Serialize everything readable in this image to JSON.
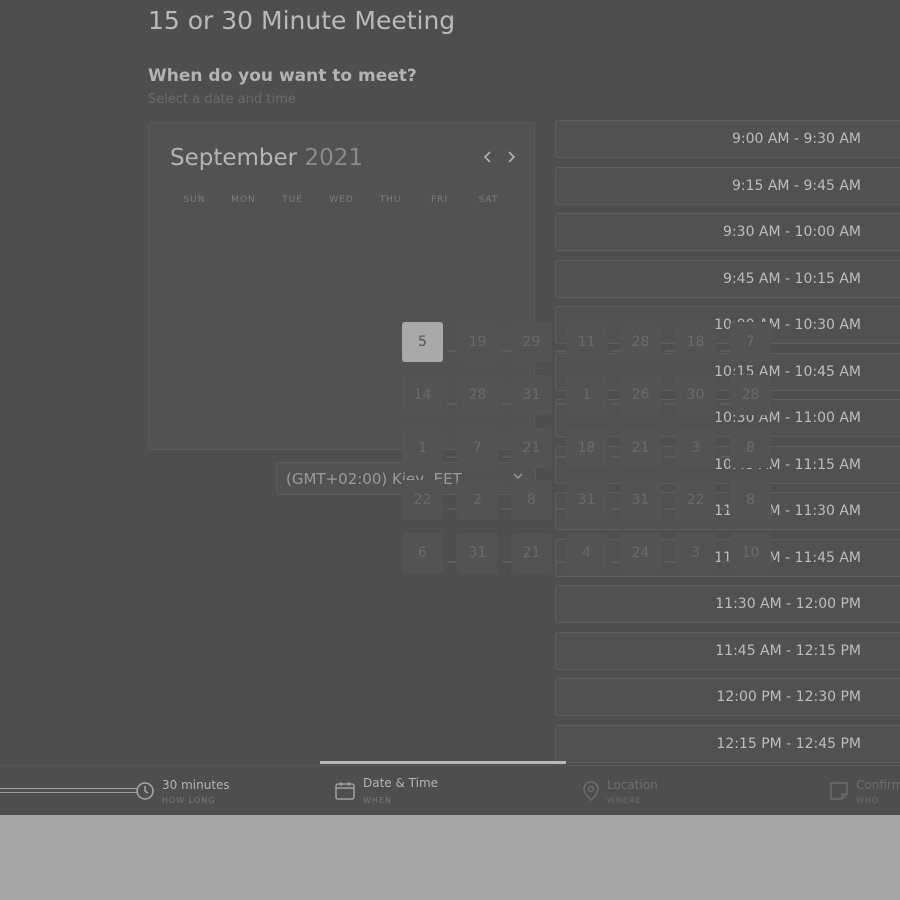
{
  "page": {
    "title": "15 or 30 Minute Meeting",
    "question": "When do you want to meet?",
    "question_sub": "Select a date and time"
  },
  "calendar": {
    "month": "September",
    "year": "2021",
    "weekdays": [
      "SUN",
      "MON",
      "TUE",
      "WED",
      "THU",
      "FRI",
      "SAT"
    ]
  },
  "timezone": {
    "value": "(GMT+02:00) Kiev, EET"
  },
  "time_slots": [
    "9:00 AM - 9:30 AM",
    "9:15 AM - 9:45 AM",
    "9:30 AM - 10:00 AM",
    "9:45 AM - 10:15 AM",
    "10:00 AM - 10:30 AM",
    "10:15 AM - 10:45 AM",
    "10:30 AM - 11:00 AM",
    "10:45 AM - 11:15 AM",
    "11:00 AM - 11:30 AM",
    "11:15 AM - 11:45 AM",
    "11:30 AM - 12:00 PM",
    "11:45 AM - 12:15 PM",
    "12:00 PM - 12:30 PM",
    "12:15 PM - 12:45 PM"
  ],
  "day_grid": [
    [
      "5",
      "19",
      "29",
      "11",
      "28",
      "18",
      "7"
    ],
    [
      "14",
      "28",
      "31",
      "1",
      "26",
      "30",
      "28"
    ],
    [
      "1",
      "7",
      "21",
      "18",
      "21",
      "3",
      "8"
    ],
    [
      "22",
      "2",
      "8",
      "31",
      "31",
      "22",
      "8"
    ],
    [
      "6",
      "31",
      "21",
      "4",
      "24",
      "3",
      "10"
    ]
  ],
  "selected_day": "5",
  "footer": {
    "duration": {
      "label": "30 minutes",
      "sub": "HOW LONG"
    },
    "datetime": {
      "label": "Date & Time",
      "sub": "WHEN"
    },
    "location": {
      "label": "Location",
      "sub": "WHERE"
    },
    "confirm": {
      "label": "Confirm",
      "sub": "WHO"
    }
  },
  "icons": {
    "duration": "clock-icon",
    "datetime": "calendar-icon",
    "location": "pin-icon",
    "confirm": "note-icon"
  }
}
